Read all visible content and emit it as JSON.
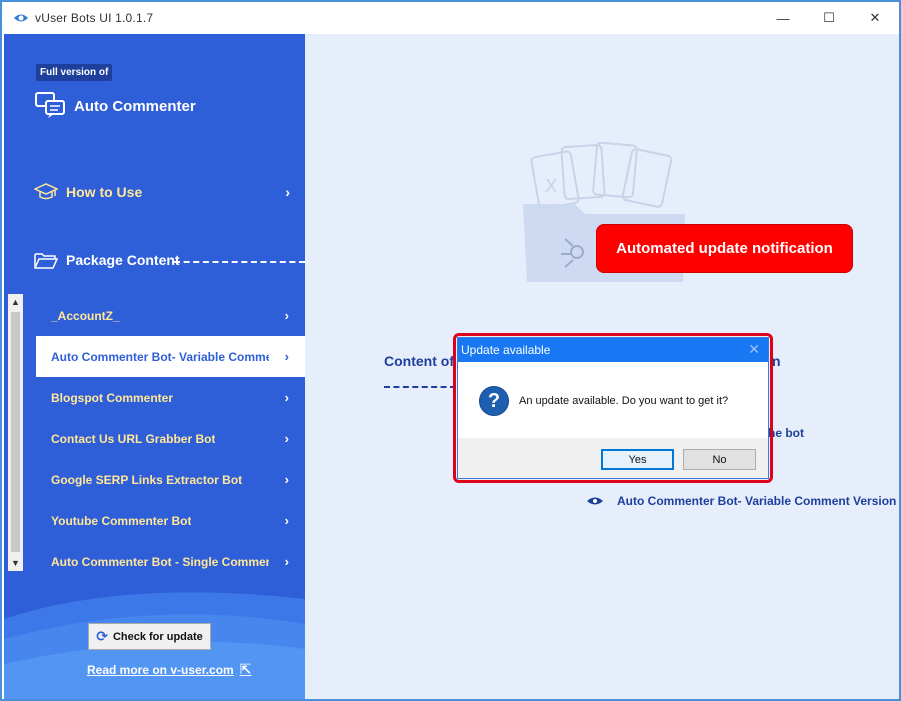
{
  "window": {
    "title": "vUser Bots UI 1.0.1.7",
    "min_icon": "—",
    "max_icon": "☐",
    "close_icon": "✕"
  },
  "sidebar": {
    "badge": "Full version of",
    "product_name": "Auto Commenter",
    "how_to_use": "How to Use",
    "package_content": "Package Content",
    "chevron": "›",
    "scroll_up": "▲",
    "scroll_down": "▼",
    "items": [
      {
        "label": "_AccountZ_"
      },
      {
        "label": "Auto Commenter Bot- Variable Comment Version"
      },
      {
        "label": "Blogspot Commenter"
      },
      {
        "label": "Contact Us URL Grabber Bot"
      },
      {
        "label": "Google SERP Links Extractor Bot"
      },
      {
        "label": "Youtube Commenter Bot"
      },
      {
        "label": "Auto Commenter Bot - Single Comment"
      }
    ],
    "check_update": "Check for update",
    "check_update_icon": "⟳",
    "read_more": "Read more on v-user.com",
    "read_more_icon": "⇱"
  },
  "main": {
    "notification": "Automated update notification",
    "content_title_left": "Content of",
    "content_title_right": "n",
    "bot_fragment": "he bot",
    "content_item": "Auto Commenter Bot- Variable Comment Version"
  },
  "dialog": {
    "title": "Update available",
    "close_icon": "✕",
    "question_icon": "?",
    "message": "An update available. Do you want to get it?",
    "yes": "Yes",
    "no": "No"
  },
  "colors": {
    "sidebar": "#2f5fd8",
    "menu_text": "#ffe79a",
    "main_bg": "#e6eefb",
    "notification": "#ff0000",
    "dialog_title": "#1877f2"
  }
}
